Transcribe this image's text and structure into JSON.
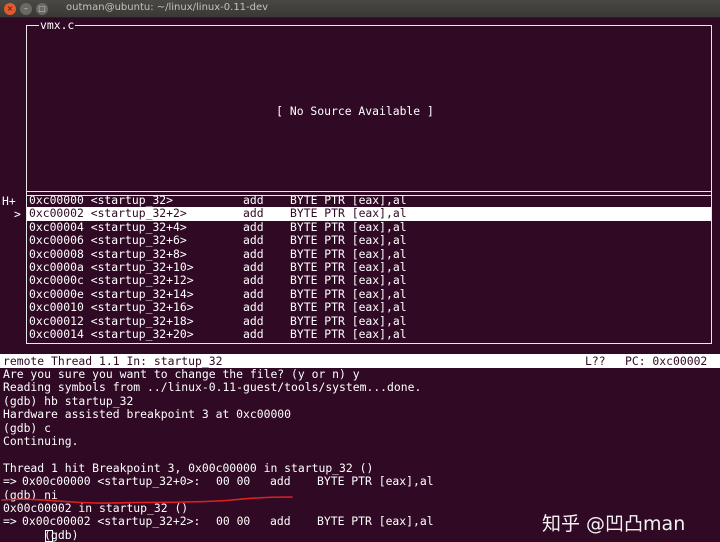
{
  "window": {
    "title": "outman@ubuntu: ~/linux/linux-0.11-dev",
    "close_glyph": "×",
    "minimize_glyph": "–",
    "maximize_glyph": "□"
  },
  "source_pane": {
    "title": "vmx.c",
    "message": "[ No Source Available ]"
  },
  "asm_pane": {
    "margin_marker": "H+",
    "current_marker": ">",
    "rows": [
      {
        "address": "0xc00000 <startup_32>",
        "mnemonic": "add",
        "operands": "BYTE PTR [eax],al"
      },
      {
        "address": "0xc00002 <startup_32+2>",
        "mnemonic": "add",
        "operands": "BYTE PTR [eax],al"
      },
      {
        "address": "0xc00004 <startup_32+4>",
        "mnemonic": "add",
        "operands": "BYTE PTR [eax],al"
      },
      {
        "address": "0xc00006 <startup_32+6>",
        "mnemonic": "add",
        "operands": "BYTE PTR [eax],al"
      },
      {
        "address": "0xc00008 <startup_32+8>",
        "mnemonic": "add",
        "operands": "BYTE PTR [eax],al"
      },
      {
        "address": "0xc0000a <startup_32+10>",
        "mnemonic": "add",
        "operands": "BYTE PTR [eax],al"
      },
      {
        "address": "0xc0000c <startup_32+12>",
        "mnemonic": "add",
        "operands": "BYTE PTR [eax],al"
      },
      {
        "address": "0xc0000e <startup_32+14>",
        "mnemonic": "add",
        "operands": "BYTE PTR [eax],al"
      },
      {
        "address": "0xc00010 <startup_32+16>",
        "mnemonic": "add",
        "operands": "BYTE PTR [eax],al"
      },
      {
        "address": "0xc00012 <startup_32+18>",
        "mnemonic": "add",
        "operands": "BYTE PTR [eax],al"
      },
      {
        "address": "0xc00014 <startup_32+20>",
        "mnemonic": "add",
        "operands": "BYTE PTR [eax],al"
      }
    ]
  },
  "status_bar": {
    "left": "remote Thread 1.1 In: startup_32",
    "line": "L??",
    "pc": "PC: 0xc00002"
  },
  "console": {
    "lines": [
      "Are you sure you want to change the file? (y or n) y",
      "Reading symbols from ../linux-0.11-guest/tools/system...done.",
      "(gdb) hb startup_32",
      "Hardware assisted breakpoint 3 at 0xc00000",
      "(gdb) c",
      "Continuing.",
      "",
      "Thread 1 hit Breakpoint 3, 0x00c00000 in startup_32 ()"
    ],
    "instr1": {
      "arrow": "=>",
      "addr": "0x00c00000 <startup_32+0>:",
      "bytes": "00 00",
      "mnemonic": "add",
      "operands": "BYTE PTR [eax],al"
    },
    "ni_cmd": "(gdb) ni",
    "frame_line": "0x00c00002 in startup_32 ()",
    "instr2": {
      "arrow": "=>",
      "addr": "0x00c00002 <startup_32+2>:",
      "bytes": "00 00",
      "mnemonic": "add",
      "operands": "BYTE PTR [eax],al"
    },
    "prompt": "(gdb) "
  },
  "watermark": "知乎 @凹凸man",
  "colors": {
    "terminal_bg": "#300a24",
    "foreground": "#ffffff",
    "annotation_red": "#e02020"
  }
}
